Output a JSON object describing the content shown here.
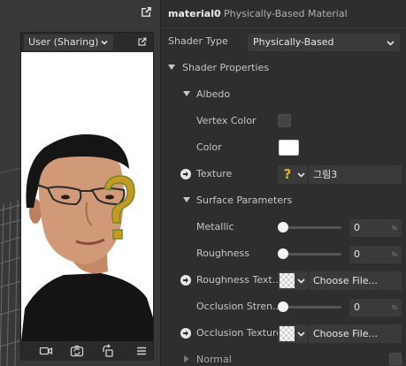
{
  "viewport": {
    "camera_select": {
      "label": "User (Sharing)"
    },
    "icons": [
      "external-link-icon",
      "video-camera-icon",
      "camera-switch-icon",
      "rotate-icon",
      "menu-icon"
    ]
  },
  "inspector": {
    "title_name": "material0",
    "title_sub": " – Physically-Based Material",
    "shader_type": {
      "label": "Shader Type",
      "value": "Physically-Based"
    },
    "sections": {
      "shader_properties": "Shader Properties",
      "albedo": "Albedo",
      "surface_parameters": "Surface Parameters",
      "normal": "Normal"
    },
    "albedo": {
      "vertex_color_label": "Vertex Color",
      "vertex_color_checked": false,
      "color_label": "Color",
      "color_value": "#ffffff",
      "texture_label": "Texture",
      "texture_value": "그림3"
    },
    "surface": {
      "metallic_label": "Metallic",
      "metallic_value": "0",
      "metallic_fraction": 0,
      "roughness_label": "Roughness",
      "roughness_value": "0",
      "roughness_fraction": 0,
      "roughness_texture_label": "Roughness Text...",
      "roughness_texture_value": "Choose File...",
      "occlusion_strength_label": "Occlusion Stren...",
      "occlusion_strength_value": "0",
      "occlusion_strength_fraction": 0,
      "occlusion_texture_label": "Occlusion Texture",
      "occlusion_texture_value": "Choose File...",
      "unit": "%"
    }
  },
  "colors": {
    "accent_question": "#e6b40c",
    "panel_bg": "#2e2e2e",
    "field_bg": "#3a3a3a"
  }
}
